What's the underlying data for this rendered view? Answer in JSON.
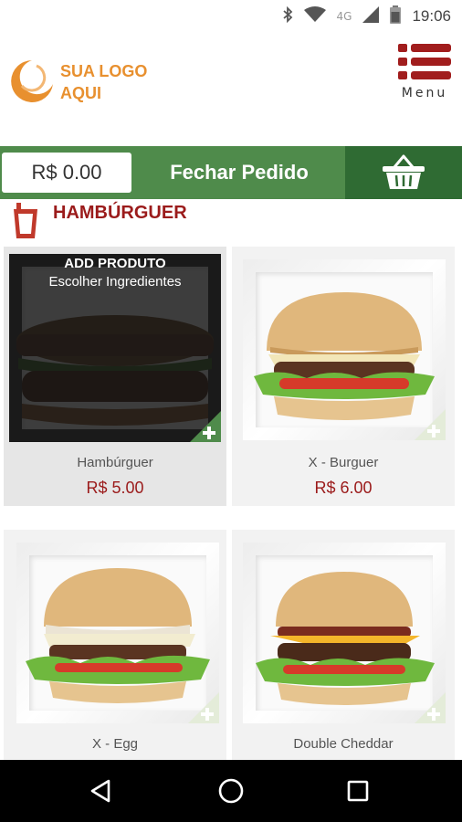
{
  "status_bar": {
    "network": "4G",
    "time": "19:06"
  },
  "header": {
    "logo_line1": "SUA LOGO",
    "logo_line2": "AQUI",
    "menu_label": "Menu",
    "logo_color": "#e8902f",
    "menu_icon_color": "#a11d1d"
  },
  "order_bar": {
    "total": "R$ 0.00",
    "close_label": "Fechar Pedido",
    "bar_color": "#4f8b4b",
    "basket_color": "#2f6b33"
  },
  "category": {
    "title": "HAMBÚRGUER",
    "icon": "cup-icon",
    "color": "#9b1b1b"
  },
  "products": [
    {
      "name": "Hambúrguer",
      "price": "R$ 5.00",
      "overlay_title": "ADD PRODUTO",
      "overlay_subtitle": "Escolher Ingredientes"
    },
    {
      "name": "X - Burguer",
      "price": "R$ 6.00"
    },
    {
      "name": "X - Egg",
      "price": ""
    },
    {
      "name": "Double Cheddar",
      "price": ""
    }
  ],
  "nav": {
    "back": "back-icon",
    "home": "home-icon",
    "recents": "recents-icon"
  }
}
